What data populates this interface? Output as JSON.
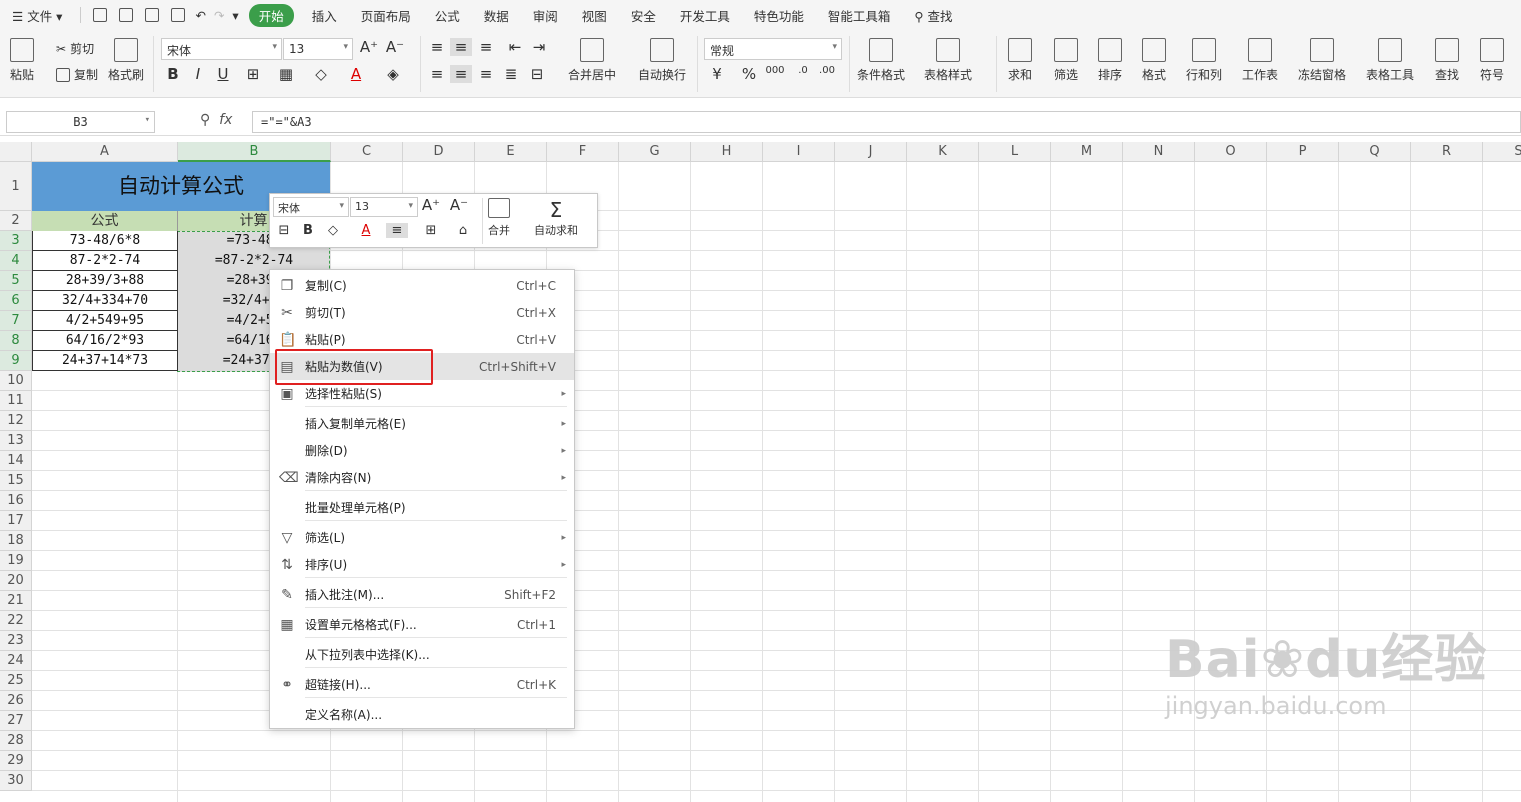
{
  "menubar": {
    "file": "文件",
    "tabs": [
      "开始",
      "插入",
      "页面布局",
      "公式",
      "数据",
      "审阅",
      "视图",
      "安全",
      "开发工具",
      "特色功能",
      "智能工具箱"
    ],
    "search": "查找"
  },
  "ribbon": {
    "paste": "粘贴",
    "cut": "剪切",
    "copy": "复制",
    "format_painter": "格式刷",
    "font": "宋体",
    "size": "13",
    "merge": "合并居中",
    "wrap": "自动换行",
    "number_format": "常规",
    "cond_format": "条件格式",
    "table_style": "表格样式",
    "sum": "求和",
    "filter": "筛选",
    "sort": "排序",
    "format": "格式",
    "row_col": "行和列",
    "worksheet": "工作表",
    "freeze": "冻结窗格",
    "table_tools": "表格工具",
    "find": "查找",
    "symbol": "符号"
  },
  "formula_bar": {
    "cell_ref": "B3",
    "fx": "fx",
    "formula": "=\"=\"&A3"
  },
  "columns": [
    "A",
    "B",
    "C",
    "D",
    "E",
    "F",
    "G",
    "H",
    "I",
    "J",
    "K",
    "L",
    "M",
    "N",
    "O",
    "P",
    "Q",
    "R",
    "S"
  ],
  "rows": [
    "1",
    "2",
    "3",
    "4",
    "5",
    "6",
    "7",
    "8",
    "9",
    "10",
    "11",
    "12",
    "13",
    "14",
    "15",
    "16",
    "17",
    "18",
    "19",
    "20",
    "21",
    "22",
    "23",
    "24",
    "25",
    "26",
    "27",
    "28",
    "29",
    "30"
  ],
  "sheet": {
    "title": "自动计算公式",
    "header_a": "公式",
    "header_b": "计算",
    "col_a": [
      "73-48/6*8",
      "87-2*2-74",
      "28+39/3+88",
      "32/4+334+70",
      "4/2+549+95",
      "64/16/2*93",
      "24+37+14*73"
    ],
    "col_b": [
      "=73-48/",
      "=87-2*2-74",
      "=28+39/",
      "=32/4+33",
      "=4/2+54",
      "=64/16/",
      "=24+37+1"
    ]
  },
  "mini_toolbar": {
    "font": "宋体",
    "size": "13",
    "merge": "合并",
    "autosum": "自动求和"
  },
  "context_menu": [
    {
      "label": "复制(C)",
      "shortcut": "Ctrl+C",
      "icon": "copy-icon"
    },
    {
      "label": "剪切(T)",
      "shortcut": "Ctrl+X",
      "icon": "scissors-icon"
    },
    {
      "label": "粘贴(P)",
      "shortcut": "Ctrl+V",
      "icon": "paste-icon"
    },
    {
      "label": "粘贴为数值(V)",
      "shortcut": "Ctrl+Shift+V",
      "icon": "paste-values-icon"
    },
    {
      "label": "选择性粘贴(S)",
      "shortcut": "",
      "icon": "paste-special-icon"
    },
    {
      "label": "插入复制单元格(E)",
      "shortcut": "",
      "icon": ""
    },
    {
      "label": "删除(D)",
      "shortcut": "",
      "icon": ""
    },
    {
      "label": "清除内容(N)",
      "shortcut": "",
      "icon": "eraser-icon"
    },
    {
      "label": "批量处理单元格(P)",
      "shortcut": "",
      "icon": ""
    },
    {
      "label": "筛选(L)",
      "shortcut": "",
      "icon": "filter-icon"
    },
    {
      "label": "排序(U)",
      "shortcut": "",
      "icon": "sort-icon"
    },
    {
      "label": "插入批注(M)...",
      "shortcut": "Shift+F2",
      "icon": "comment-icon"
    },
    {
      "label": "设置单元格格式(F)...",
      "shortcut": "Ctrl+1",
      "icon": "format-cells-icon"
    },
    {
      "label": "从下拉列表中选择(K)...",
      "shortcut": "",
      "icon": ""
    },
    {
      "label": "超链接(H)...",
      "shortcut": "Ctrl+K",
      "icon": "link-icon"
    },
    {
      "label": "定义名称(A)...",
      "shortcut": "",
      "icon": ""
    }
  ],
  "watermark": {
    "brand": "Bai",
    "brand2": "du",
    "cn": "经验",
    "url": "jingyan.baidu.com"
  }
}
